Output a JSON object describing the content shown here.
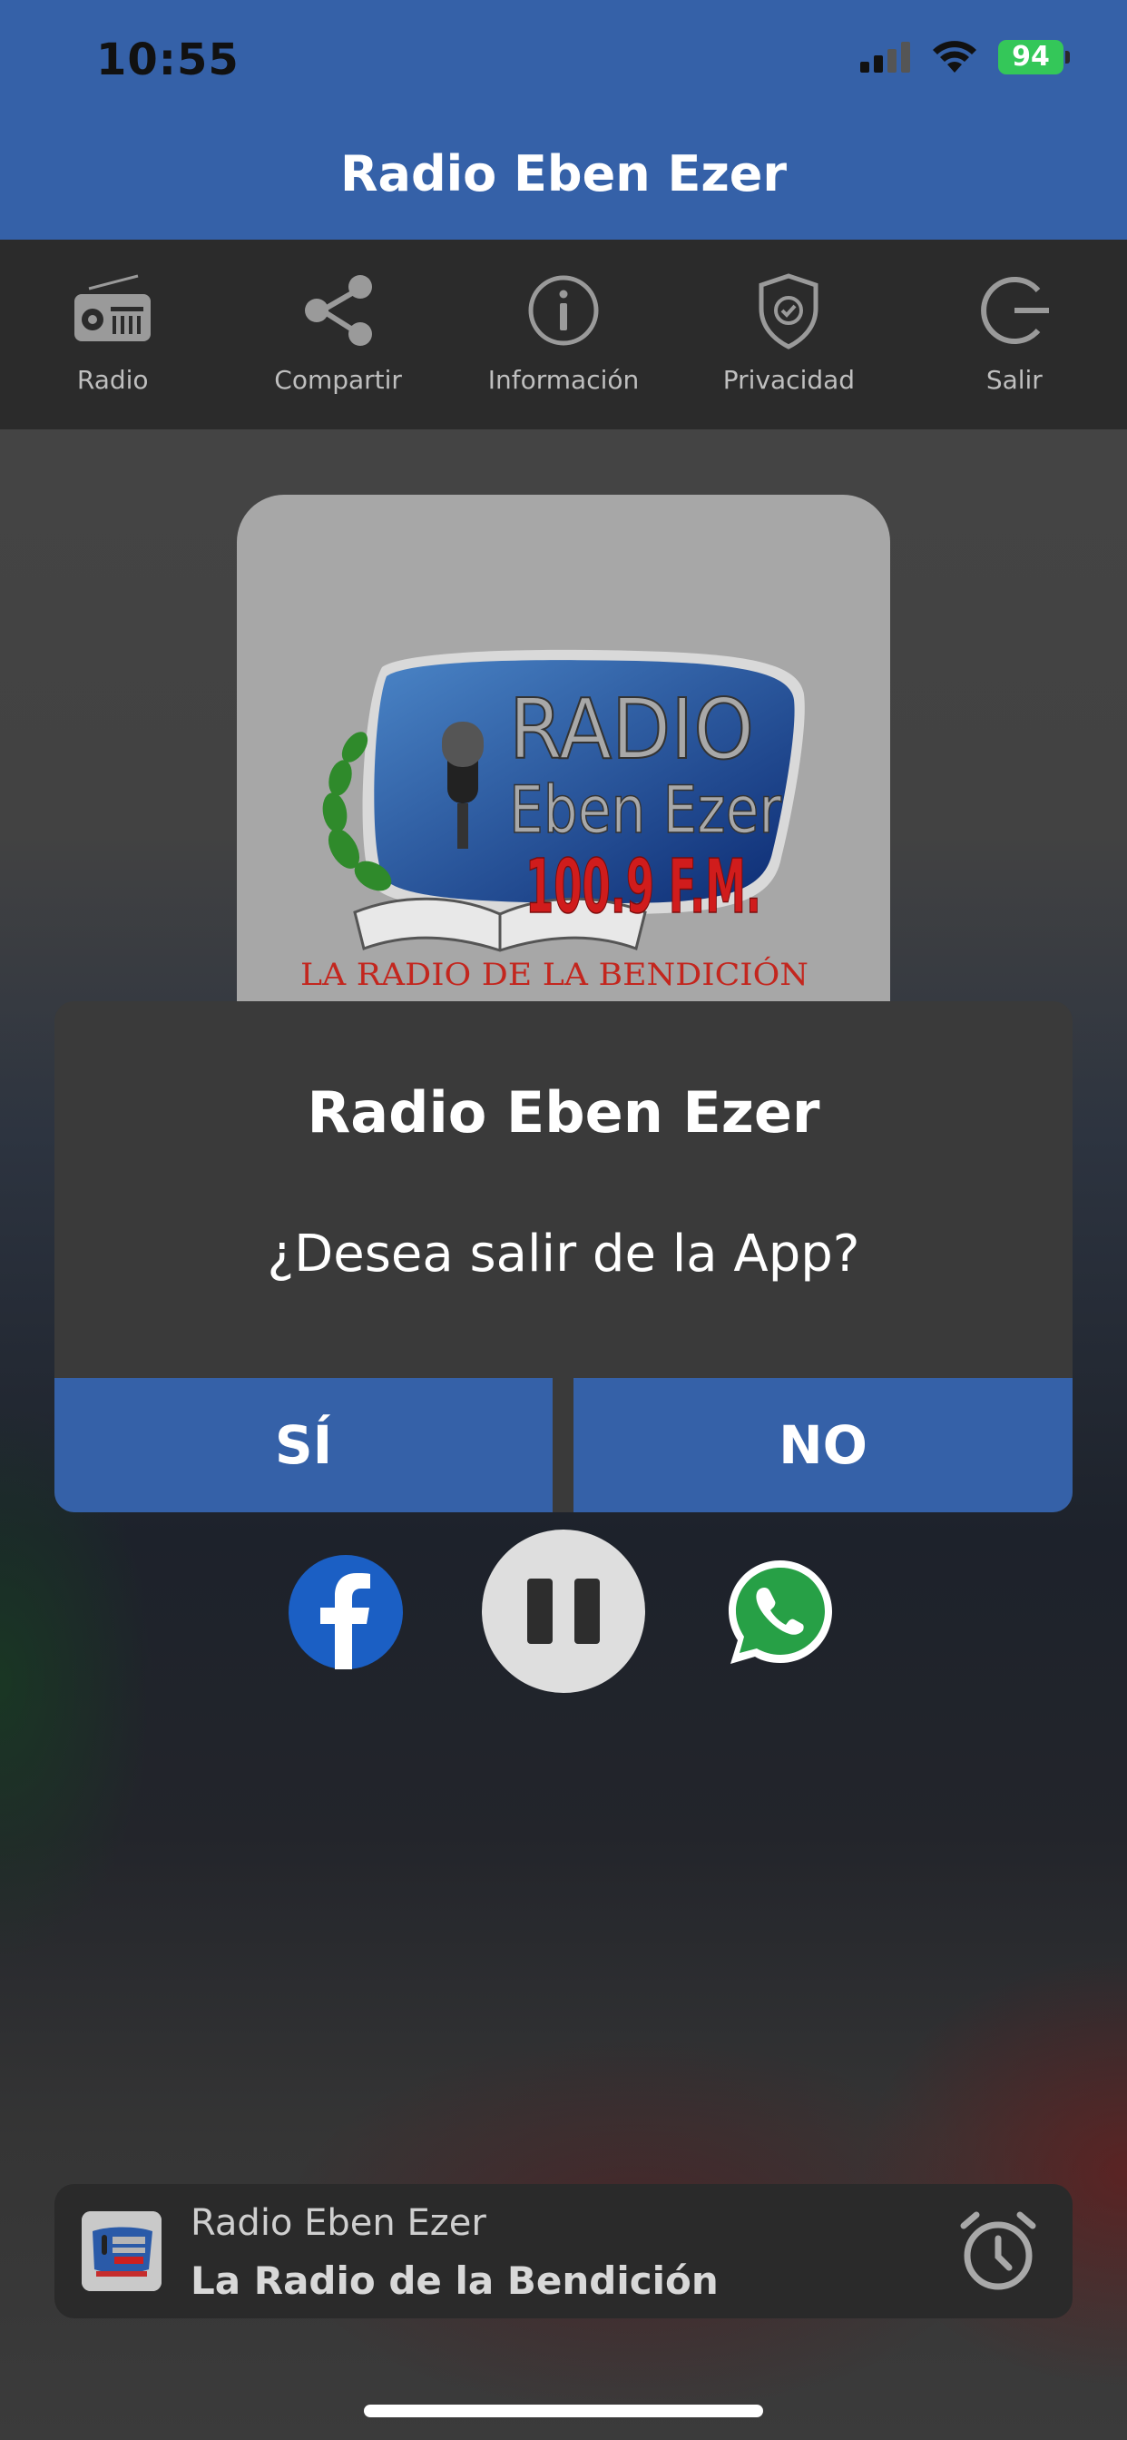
{
  "status_bar": {
    "time": "10:55",
    "battery": "94"
  },
  "header": {
    "title": "Radio Eben Ezer"
  },
  "toolbar": {
    "items": [
      {
        "label": "Radio",
        "icon": "radio-icon"
      },
      {
        "label": "Compartir",
        "icon": "share-icon"
      },
      {
        "label": "Información",
        "icon": "info-icon"
      },
      {
        "label": "Privacidad",
        "icon": "shield-check-icon"
      },
      {
        "label": "Salir",
        "icon": "logout-icon"
      }
    ]
  },
  "artwork": {
    "line1": "RADIO",
    "line2": "Eben Ezer",
    "line3": "100.9 F.M.",
    "tagline": "LA RADIO DE LA BENDICIÓN"
  },
  "dialog": {
    "title": "Radio Eben Ezer",
    "message": "¿Desea salir de la App?",
    "yes_label": "SÍ",
    "no_label": "NO"
  },
  "controls": {
    "icons": [
      "facebook-icon",
      "pause-icon",
      "whatsapp-icon"
    ]
  },
  "mini_player": {
    "title": "Radio Eben Ezer",
    "subtitle": "La Radio de la Bendición",
    "icon": "alarm-clock-icon"
  },
  "colors": {
    "primary": "#3561a8",
    "toolbar": "#2b2b2b",
    "dialog": "#3a3a3a",
    "battery": "#34c759"
  }
}
